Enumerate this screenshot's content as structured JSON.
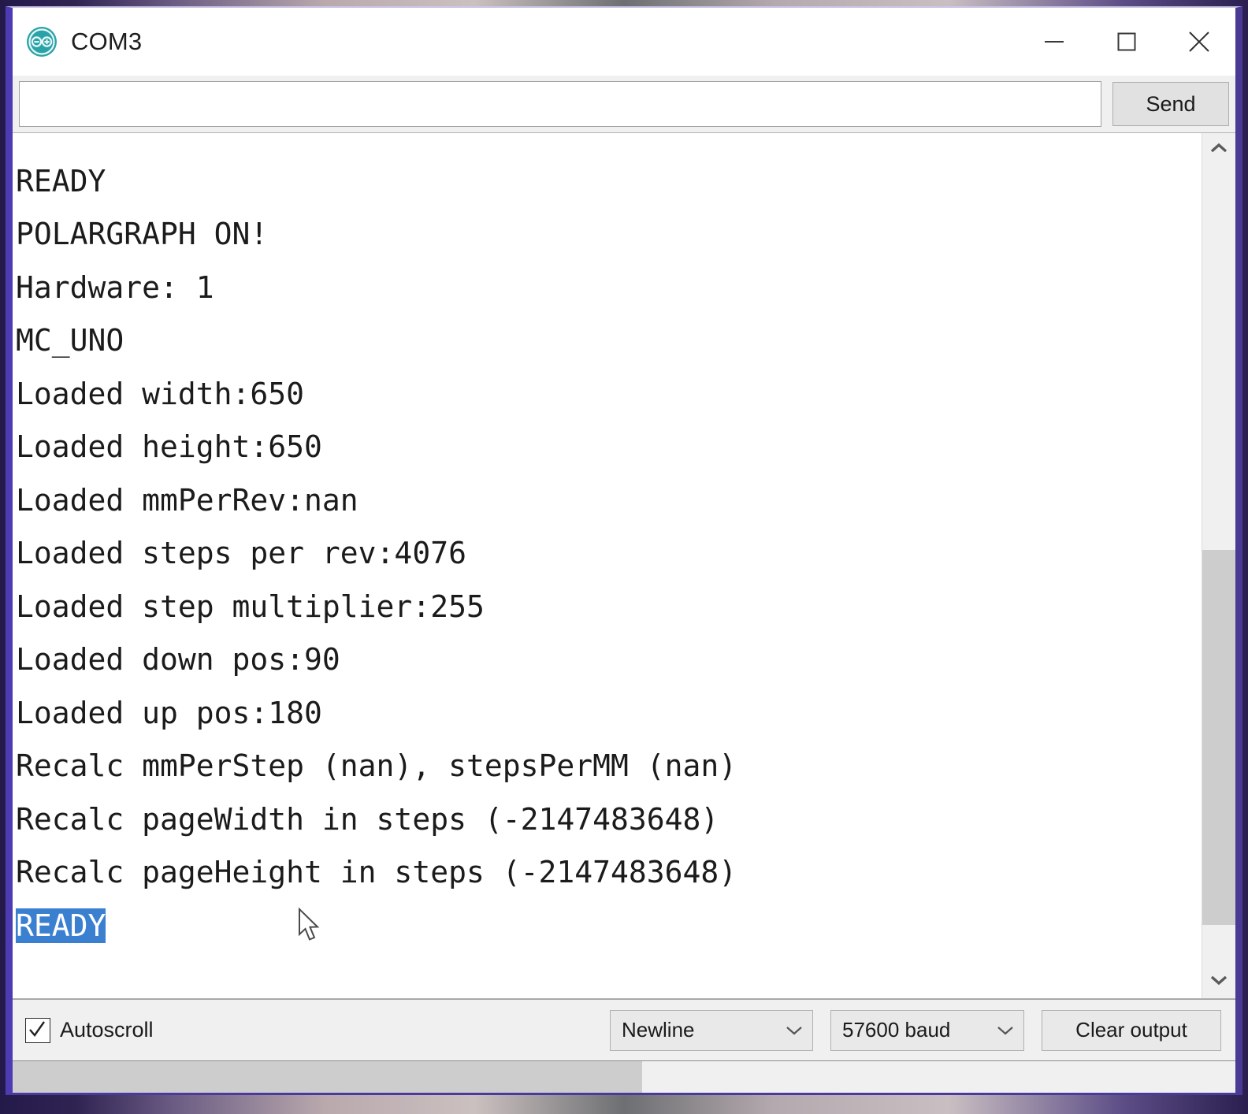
{
  "window": {
    "title": "COM3",
    "app_icon": "arduino-logo-icon",
    "controls": {
      "minimize": "minimize-icon",
      "maximize": "maximize-icon",
      "close": "close-icon"
    }
  },
  "send_row": {
    "input_value": "",
    "input_placeholder": "",
    "send_label": "Send"
  },
  "console": {
    "lines": [
      {
        "text": "",
        "selected": false,
        "clipped": true
      },
      {
        "text": "READY",
        "selected": false
      },
      {
        "text": "POLARGRAPH ON!",
        "selected": false
      },
      {
        "text": "Hardware: 1",
        "selected": false
      },
      {
        "text": "MC_UNO",
        "selected": false
      },
      {
        "text": "Loaded width:650",
        "selected": false
      },
      {
        "text": "Loaded height:650",
        "selected": false
      },
      {
        "text": "Loaded mmPerRev:nan",
        "selected": false
      },
      {
        "text": "Loaded steps per rev:4076",
        "selected": false
      },
      {
        "text": "Loaded step multiplier:255",
        "selected": false
      },
      {
        "text": "Loaded down pos:90",
        "selected": false
      },
      {
        "text": "Loaded up pos:180",
        "selected": false
      },
      {
        "text": "Recalc mmPerStep (nan), stepsPerMM (nan)",
        "selected": false
      },
      {
        "text": "Recalc pageWidth in steps (-2147483648)",
        "selected": false
      },
      {
        "text": "Recalc pageHeight in steps (-2147483648)",
        "selected": false
      },
      {
        "text": "READY",
        "selected": true
      }
    ],
    "selection_background": "#3b80d0",
    "selection_text_color": "#ffffff",
    "text_color": "#1b1b1b",
    "background": "#ffffff"
  },
  "scrollbars": {
    "vertical": {
      "up_arrow": "chevron-up-icon",
      "down_arrow": "chevron-down-icon",
      "thumb_top_percent": 48,
      "thumb_height_percent": 47
    },
    "horizontal": {
      "thumb_left_percent": 0,
      "thumb_width_percent": 51.5
    }
  },
  "options_bar": {
    "autoscroll_label": "Autoscroll",
    "autoscroll_checked": true,
    "line_ending": "Newline",
    "baud_rate": "57600 baud",
    "clear_label": "Clear output"
  },
  "colors": {
    "window_border_left": "#4c3bb2",
    "window_border_right": "#4b3a93",
    "titlebar_background": "#ffffff",
    "toolbar_background": "#f0f0f0",
    "button_face": "#e1e1e1"
  }
}
